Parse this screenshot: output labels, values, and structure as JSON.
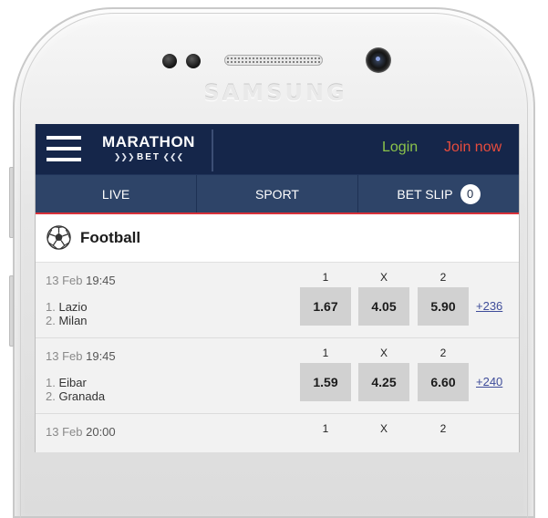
{
  "device": {
    "brand_label": "SAMSUNG"
  },
  "header": {
    "logo_main": "MARATHON",
    "logo_sub": "BET",
    "login_label": "Login",
    "join_label": "Join now"
  },
  "nav": {
    "live_label": "LIVE",
    "sport_label": "SPORT",
    "betslip_label": "BET SLIP",
    "betslip_count": "0"
  },
  "section": {
    "title": "Football"
  },
  "matches": [
    {
      "day": "13 Feb",
      "time": "19:45",
      "team1_num": "1.",
      "team1": "Lazio",
      "team2_num": "2.",
      "team2": "Milan",
      "col1": "1",
      "colx": "X",
      "col2": "2",
      "odd1": "1.67",
      "oddx": "4.05",
      "odd2": "5.90",
      "more": "+236"
    },
    {
      "day": "13 Feb",
      "time": "19:45",
      "team1_num": "1.",
      "team1": "Eibar",
      "team2_num": "2.",
      "team2": "Granada",
      "col1": "1",
      "colx": "X",
      "col2": "2",
      "odd1": "1.59",
      "oddx": "4.25",
      "odd2": "6.60",
      "more": "+240"
    },
    {
      "day": "13 Feb",
      "time": "20:00",
      "col1": "1",
      "colx": "X",
      "col2": "2"
    }
  ],
  "colors": {
    "header_bg": "#15264a",
    "nav_bg": "#2e4468",
    "accent_red": "#d9323a",
    "login_green": "#8bc34a",
    "join_red": "#e84c3d",
    "odd_bg": "#d1d1d1"
  }
}
